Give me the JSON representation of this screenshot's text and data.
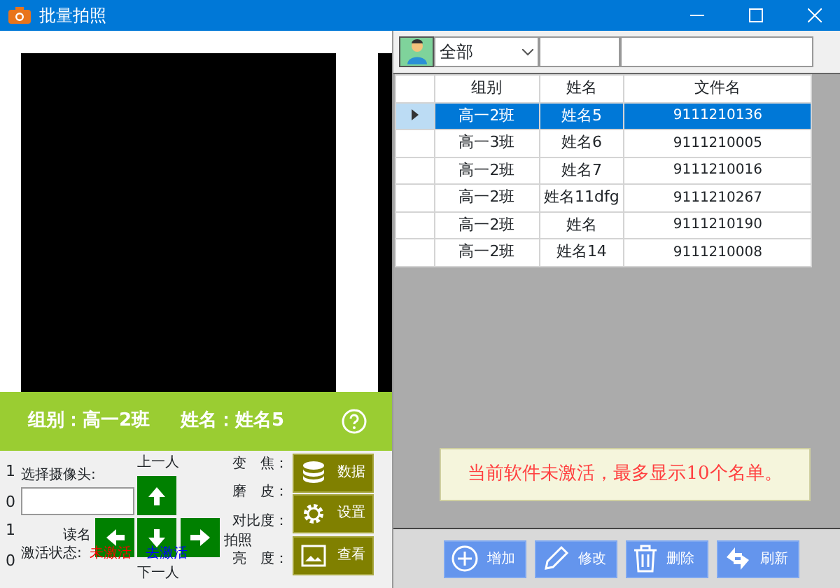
{
  "window": {
    "title": "批量拍照"
  },
  "info_bar": {
    "group": "组别：高一2班",
    "name": "姓名：姓名5"
  },
  "controls": {
    "side_numbers": [
      "1",
      "0",
      "1",
      "0"
    ],
    "camera_label": "选择摄像头:",
    "prev_label": "上一人",
    "next_label": "下一人",
    "read_label": "读名",
    "shoot_label": "拍照",
    "status_label": "激活状态:",
    "status_value": "未激活",
    "deactivate_link": "去激活",
    "adjustments": [
      "变　焦：",
      "磨　皮：",
      "对比度：",
      "亮　度："
    ],
    "buttons": [
      {
        "label": "数据"
      },
      {
        "label": "设置"
      },
      {
        "label": "查看"
      }
    ]
  },
  "filter": {
    "group": "全部"
  },
  "table": {
    "columns": [
      "组别",
      "姓名",
      "文件名"
    ],
    "rows": [
      {
        "cells": [
          "高一2班",
          "姓名5",
          "9111210136"
        ],
        "selected": true
      },
      {
        "cells": [
          "高一3班",
          "姓名6",
          "9111210005"
        ],
        "selected": false
      },
      {
        "cells": [
          "高一2班",
          "姓名7",
          "9111210016"
        ],
        "selected": false
      },
      {
        "cells": [
          "高一2班",
          "姓名11dfg",
          "9111210267"
        ],
        "selected": false
      },
      {
        "cells": [
          "高一2班",
          "姓名",
          "9111210190"
        ],
        "selected": false
      },
      {
        "cells": [
          "高一2班",
          "姓名14",
          "9111210008"
        ],
        "selected": false
      }
    ]
  },
  "notice": "当前软件未激活，最多显示10个名单。",
  "actions": [
    {
      "label": "增加"
    },
    {
      "label": "修改"
    },
    {
      "label": "删除"
    },
    {
      "label": "刷新"
    }
  ]
}
